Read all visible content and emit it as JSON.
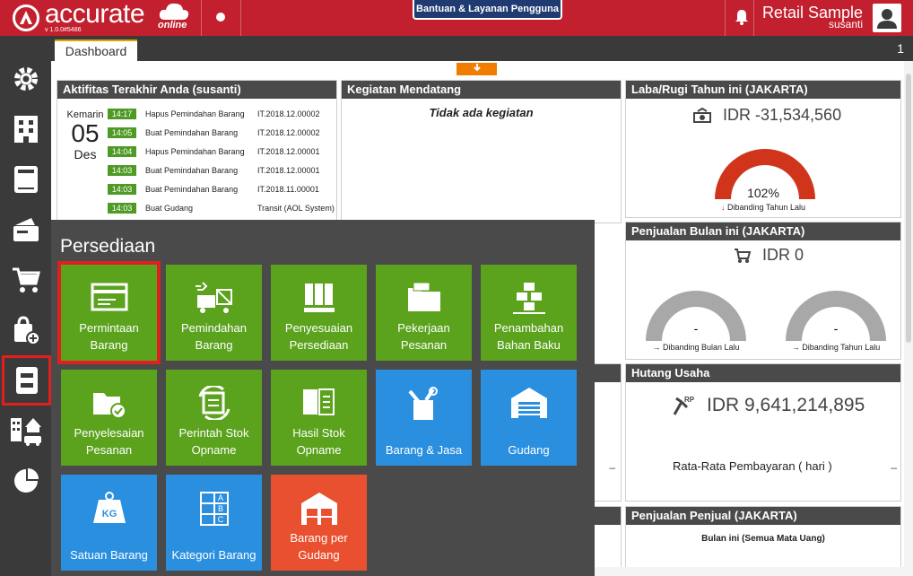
{
  "header": {
    "brand": "accurate",
    "brand_suffix": "online",
    "version": "v 1.0.0#5486",
    "help_button": "Bantuan & Layanan Pengguna",
    "company": "Retail Sample",
    "user": "susanti"
  },
  "tabs": [
    {
      "label": "Dashboard"
    }
  ],
  "tab_counter": "1",
  "activity": {
    "title": "Aktifitas Terakhir Anda (susanti)",
    "date_label": "Kemarin",
    "day": "05",
    "month": "Des",
    "rows": [
      {
        "time": "14:17",
        "desc": "Hapus Pemindahan Barang",
        "ref": "IT.2018.12.00002"
      },
      {
        "time": "14:05",
        "desc": "Buat Pemindahan Barang",
        "ref": "IT.2018.12.00002"
      },
      {
        "time": "14:04",
        "desc": "Hapus Pemindahan Barang",
        "ref": "IT.2018.12.00001"
      },
      {
        "time": "14:03",
        "desc": "Buat Pemindahan Barang",
        "ref": "IT.2018.12.00001"
      },
      {
        "time": "14:03",
        "desc": "Buat Pemindahan Barang",
        "ref": "IT.2018.11.00001"
      },
      {
        "time": "14:03",
        "desc": "Buat Gudang",
        "ref": "Transit (AOL System)"
      }
    ]
  },
  "upcoming": {
    "title": "Kegiatan Mendatang",
    "empty": "Tidak ada kegiatan"
  },
  "profit": {
    "title": "Laba/Rugi Tahun ini (JAKARTA)",
    "value": "IDR -31,534,560",
    "percent": "102%",
    "percent_fill": 1.0,
    "note": "Dibanding Tahun Lalu"
  },
  "sales_month": {
    "title": "Penjualan Bulan ini (JAKARTA)",
    "value": "IDR 0",
    "gauge_left_value": "-",
    "gauge_left_note": "Dibanding Bulan Lalu",
    "gauge_right_value": "-",
    "gauge_right_note": "Dibanding Tahun Lalu"
  },
  "payables": {
    "title": "Hutang Usaha",
    "value": "IDR 9,641,214,895",
    "avg_label": "Rata-Rata Pembayaran ( hari )",
    "avg_value": "–"
  },
  "salesperson": {
    "title": "Penjualan Penjual (JAKARTA)",
    "subtitle": "Bulan ini (Semua Mata Uang)"
  },
  "menu": {
    "title": "Persediaan",
    "tiles": [
      {
        "line1": "Permintaan",
        "line2": "Barang",
        "color": "#5ba21d",
        "icon": "card-icon"
      },
      {
        "line1": "Pemindahan",
        "line2": "Barang",
        "color": "#5ba21d",
        "icon": "truck-icon"
      },
      {
        "line1": "Penyesuaian",
        "line2": "Persediaan",
        "color": "#5ba21d",
        "icon": "shelves-icon"
      },
      {
        "line1": "Pekerjaan",
        "line2": "Pesanan",
        "color": "#5ba21d",
        "icon": "job-folder-icon"
      },
      {
        "line1": "Penambahan",
        "line2": "Bahan Baku",
        "color": "#5ba21d",
        "icon": "boxes-icon"
      },
      {
        "line1": "Penyelesaian",
        "line2": "Pesanan",
        "color": "#5ba21d",
        "icon": "job-done-icon"
      },
      {
        "line1": "Perintah Stok",
        "line2": "Opname",
        "color": "#5ba21d",
        "icon": "stock-cycle-icon"
      },
      {
        "line1": "Hasil Stok",
        "line2": "Opname",
        "color": "#5ba21d",
        "icon": "stock-result-icon"
      },
      {
        "line1": "",
        "line2": "Barang & Jasa",
        "color": "#2b8fe0",
        "icon": "item-service-icon"
      },
      {
        "line1": "",
        "line2": "Gudang",
        "color": "#2b8fe0",
        "icon": "warehouse-icon"
      },
      {
        "line1": "",
        "line2": "Satuan Barang",
        "color": "#2b8fe0",
        "icon": "weight-icon"
      },
      {
        "line1": "",
        "line2": "Kategori Barang",
        "color": "#2b8fe0",
        "icon": "category-icon"
      },
      {
        "line1": "Barang per",
        "line2": "Gudang",
        "color": "#e9502f",
        "icon": "warehouse-items-icon"
      }
    ]
  }
}
